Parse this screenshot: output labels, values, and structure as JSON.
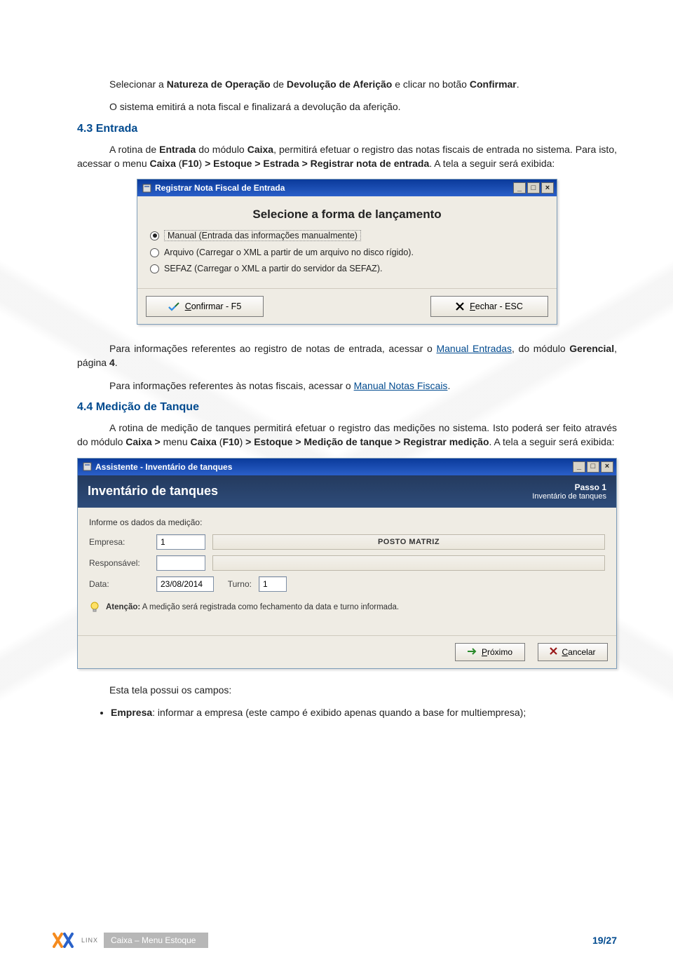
{
  "body": {
    "p1_pre": "Selecionar a ",
    "p1_b1": "Natureza de Operação",
    "p1_mid1": " de ",
    "p1_b2": "Devolução de Aferição",
    "p1_mid2": " e clicar no botão ",
    "p1_b3": "Confirmar",
    "p1_end": ".",
    "p2": "O sistema emitirá a nota fiscal e finalizará a devolução da aferição.",
    "h43": "4.3 Entrada",
    "p3_a": "A rotina de ",
    "p3_b1": "Entrada",
    "p3_b": " do módulo ",
    "p3_b2": "Caixa",
    "p3_c": ", permitirá efetuar o registro das notas fiscais de entrada no sistema. Para isto, acessar o menu ",
    "p3_b3": "Caixa",
    "p3_d": " (",
    "p3_b4": "F10",
    "p3_e": ") ",
    "p3_b5": "> Estoque > Estrada > Registrar nota de entrada",
    "p3_f": ". A tela a seguir será exibida:",
    "p4_a": "Para informações referentes ao registro de notas de entrada, acessar o ",
    "p4_link": "Manual Entradas",
    "p4_b": ", do módulo ",
    "p4_bold": "Gerencial",
    "p4_c": ", página ",
    "p4_bold2": "4",
    "p4_d": ".",
    "p5_a": "Para informações referentes às notas fiscais, acessar o ",
    "p5_link": "Manual Notas Fiscais",
    "p5_b": ".",
    "h44": "4.4 Medição de Tanque",
    "p6_a": "A rotina de medição de tanques permitirá efetuar o registro das medições no sistema. Isto poderá ser feito através do módulo ",
    "p6_b1": "Caixa >",
    "p6_b": " menu ",
    "p6_b2": "Caixa",
    "p6_c": " (",
    "p6_b3": "F10",
    "p6_d": ") ",
    "p6_b4": "> Estoque > Medição de tanque > Registrar medição",
    "p6_e": ". A tela a seguir será exibida:",
    "p7": "Esta tela possui os campos:",
    "li1_b": "Empresa",
    "li1": ": informar a empresa (este campo é exibido apenas quando a base for multiempresa);"
  },
  "dlg1": {
    "title": "Registrar Nota Fiscal de Entrada",
    "header": "Selecione a forma de lançamento",
    "opt1": "Manual (Entrada das informações manualmente)",
    "opt2": "Arquivo (Carregar o XML a partir de um arquivo no disco rígido).",
    "opt3": "SEFAZ (Carregar o XML a partir do servidor da SEFAZ).",
    "confirm_u": "C",
    "confirm_rest": "onfirmar - F5",
    "close_u": "F",
    "close_rest": "echar - ESC"
  },
  "dlg2": {
    "title": "Assistente - Inventário de tanques",
    "banner_title": "Inventário de tanques",
    "step": "Passo 1",
    "step_sub": "Inventário de tanques",
    "instr": "Informe os dados da medição:",
    "lbl_empresa": "Empresa:",
    "val_empresa_code": "1",
    "val_empresa_name": "POSTO MATRIZ",
    "lbl_resp": "Responsável:",
    "val_resp": "",
    "lbl_data": "Data:",
    "val_data": "23/08/2014",
    "lbl_turno": "Turno:",
    "val_turno": "1",
    "note_b": "Atenção:",
    "note": " A medição será registrada como fechamento da data e turno informada.",
    "btn_next_u": "P",
    "btn_next_rest": "róximo",
    "btn_cancel_u": "C",
    "btn_cancel_rest": "ancelar"
  },
  "footer": {
    "brand": "LINX",
    "crumb": "Caixa – Menu Estoque",
    "page": "19/27"
  }
}
